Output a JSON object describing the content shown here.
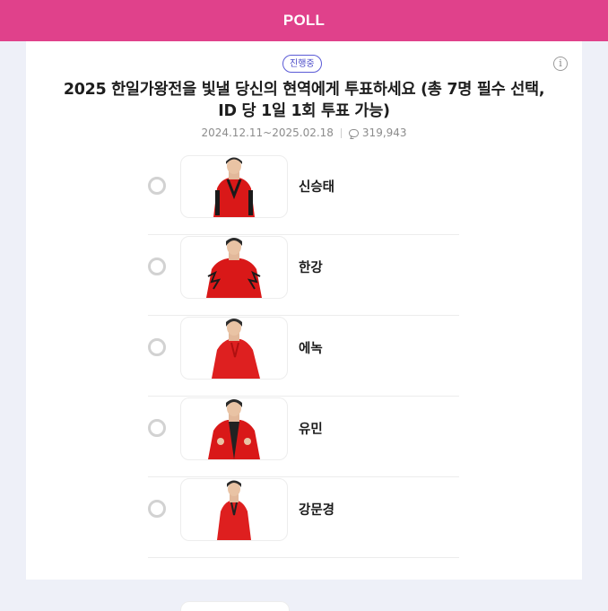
{
  "header": {
    "title": "POLL",
    "color": "#e0418b"
  },
  "poll": {
    "status": "진행중",
    "title": "2025 한일가왕전을 빛낼 당신의 현역에게 투표하세요 (총 7명 필수 선택, ID 당 1일 1회 투표 가능)",
    "period": "2024.12.11~2025.02.18",
    "comment_count": "319,943"
  },
  "options": [
    {
      "name": "신승태",
      "outfit_color": "#e01b1b"
    },
    {
      "name": "한강",
      "outfit_color": "#e01b1b"
    },
    {
      "name": "에녹",
      "outfit_color": "#e01b1b"
    },
    {
      "name": "유민",
      "outfit_color": "#e01b1b"
    },
    {
      "name": "강문경",
      "outfit_color": "#e01b1b"
    }
  ],
  "icons": {
    "info": "info-icon",
    "comment": "comment-icon"
  }
}
